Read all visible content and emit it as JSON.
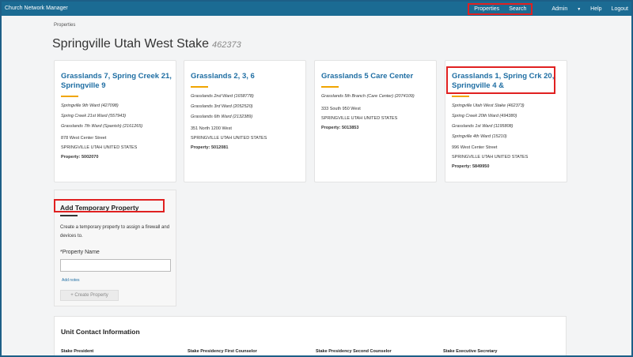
{
  "app_title": "Church Network Manager",
  "nav": {
    "properties": "Properties",
    "search": "Search",
    "admin": "Admin",
    "help": "Help",
    "logout": "Logout"
  },
  "breadcrumb": "Properties",
  "page": {
    "title": "Springville Utah West Stake",
    "code": "462373"
  },
  "cards": [
    {
      "title": "Grasslands 7, Spring Creek 21, Springville 9",
      "units": [
        "Springville 9th Ward (427098)",
        "Spring Creek 21st Ward (557943)",
        "Grasslands 7th Ward (Spanish) (2161265)"
      ],
      "street": "878 West Center Street",
      "city": "SPRINGVILLE UTAH UNITED STATES",
      "property": "Property: 5002070"
    },
    {
      "title": "Grasslands 2, 3, 6",
      "units": [
        "Grasslands 2nd Ward (1658778)",
        "Grasslands 3rd Ward (2052520)",
        "Grasslands 6th Ward (2132389)"
      ],
      "street": "351 North 1200 West",
      "city": "SPRINGVILLE UTAH UNITED STATES",
      "property": "Property: 5012081"
    },
    {
      "title": "Grasslands 5 Care Center",
      "units": [
        "Grasslands 5th Branch (Care Center) (2074109)"
      ],
      "street": "333 South 950 West",
      "city": "SPRINGVILLE UTAH UNITED STATES",
      "property": "Property: 5013853"
    },
    {
      "title": "Grasslands 1, Spring Crk 20, Springville 4 &",
      "units": [
        "Springville Utah West Stake (462373)",
        "Spring Creek 20th Ward (494380)",
        "Grasslands 1st Ward (1195808)",
        "Springville 4th Ward (15210)"
      ],
      "street": "996 West Center Street",
      "city": "SPRINGVILLE UTAH UNITED STATES",
      "property": "Property: 5849950"
    }
  ],
  "add_property": {
    "title": "Add Temporary Property",
    "description": "Create a temporary property to assign a firewall and devices to.",
    "field_label": "*Property Name",
    "field_value": "",
    "add_notes": "Add notes",
    "button": "+ Create Property"
  },
  "contact": {
    "title": "Unit Contact Information",
    "columns": [
      "Stake President",
      "Stake Presidency First Counselor",
      "Stake Presidency Second Counselor",
      "Stake Executive Secretary"
    ]
  }
}
